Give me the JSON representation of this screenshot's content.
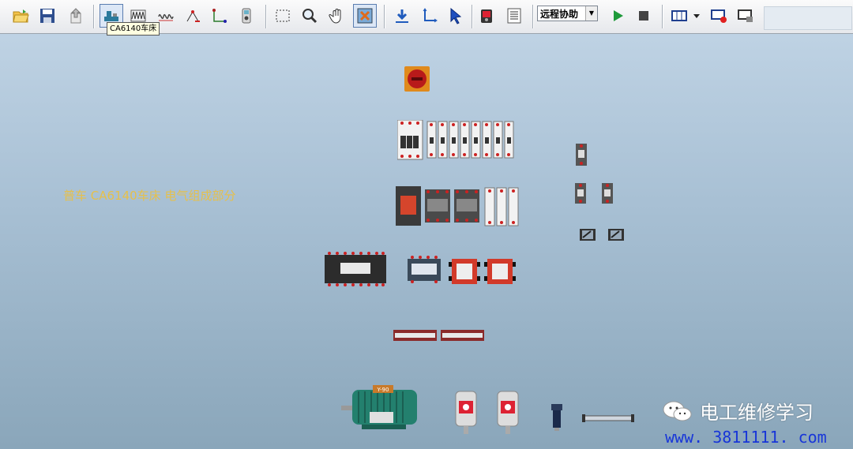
{
  "toolbar": {
    "tooltip": "CA6140车床",
    "remote_select_value": "远程协助",
    "colors": {
      "play": "#1e9a3a",
      "stop": "#444444",
      "record": "#e02020"
    }
  },
  "canvas": {
    "title": "普车 CA6140车床 电气组成部分",
    "motor_nameplate": "Y-90"
  },
  "watermark": {
    "brand": "电工维修学习",
    "url": "www. 3811111. com"
  }
}
